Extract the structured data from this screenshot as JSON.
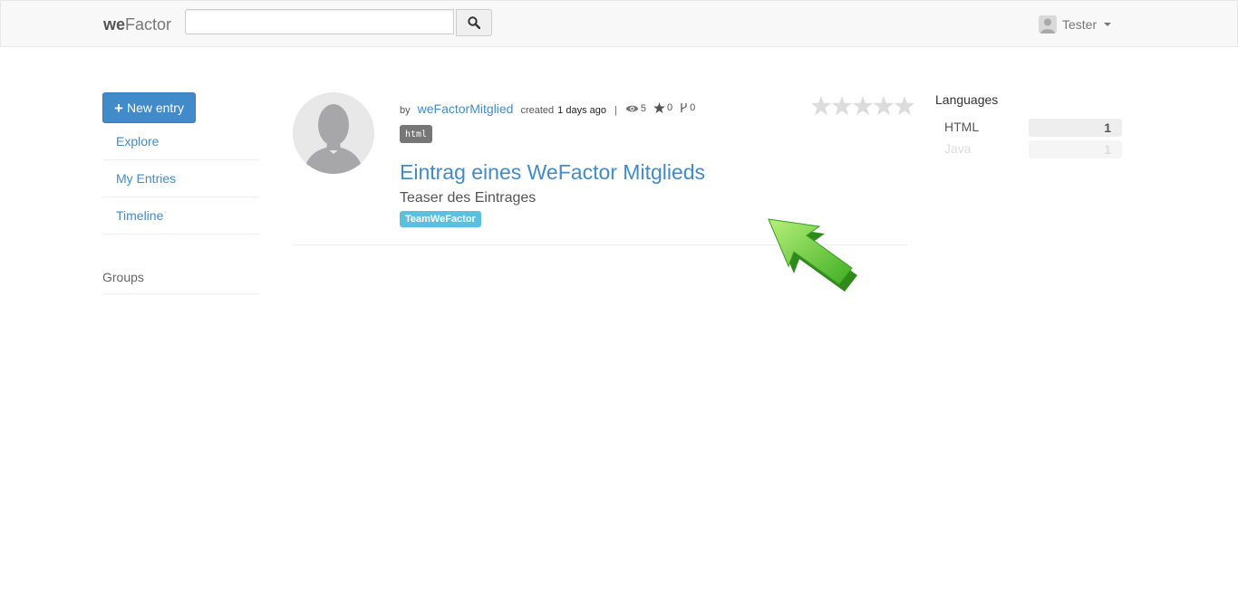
{
  "navbar": {
    "brand_bold": "we",
    "brand_rest": "Factor",
    "search": {
      "value": "",
      "placeholder": ""
    },
    "search_icon": "search-icon",
    "user_name": "Tester"
  },
  "sidebar": {
    "new_entry_label": "New entry",
    "items": [
      {
        "label": "Explore"
      },
      {
        "label": "My Entries"
      },
      {
        "label": "Timeline"
      }
    ],
    "groups_title": "Groups"
  },
  "entry": {
    "by_label": "by",
    "author": "weFactorMitglied",
    "created_label": "created",
    "created_when": "1 days ago",
    "separator": "|",
    "views": "5",
    "stars": "0",
    "forks": "0",
    "language_label": "html",
    "rating_stars": 5,
    "rating_value": 0,
    "title": "Eintrag eines WeFactor Mitglieds",
    "teaser": "Teaser des Eintrages",
    "group_badge": "TeamWeFactor"
  },
  "languages": {
    "title": "Languages",
    "items": [
      {
        "name": "HTML",
        "count": "1"
      },
      {
        "name": "Java",
        "count": "1"
      }
    ]
  },
  "colors": {
    "primary": "#428bca",
    "info": "#5bc0de",
    "arrow": "#4fc232"
  }
}
